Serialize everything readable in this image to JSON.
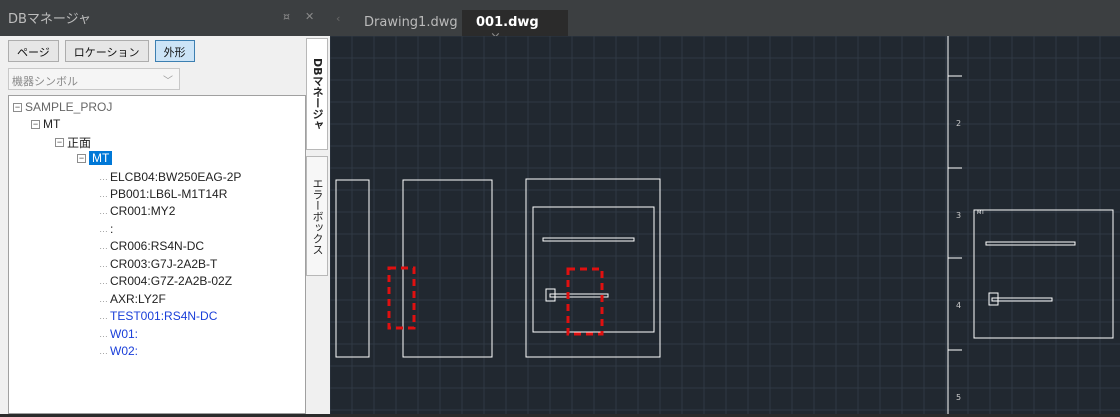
{
  "panel": {
    "title": "DBマネージャ",
    "pin_icon": "pin-icon",
    "close_icon": "close-icon",
    "buttons": [
      "ページ",
      "ロケーション",
      "外形"
    ],
    "active_button": "外形",
    "combo": {
      "value": "機器シンボル"
    }
  },
  "tree": {
    "root": "SAMPLE_PROJ",
    "mt": "MT",
    "front": "正面",
    "mt_selected": "MT",
    "items": [
      "ELCB04:BW250EAG-2P",
      "PB001:LB6L-M1T14R",
      "CR001:MY2",
      ":",
      "CR006:RS4N-DC",
      "CR003:G7J-2A2B-T",
      "CR004:G7Z-2A2B-02Z",
      "AXR:LY2F",
      "TEST001:RS4N-DC",
      "W01:",
      "W02:"
    ]
  },
  "side_tabs": [
    "DBマネージャ",
    "エラーボックス"
  ],
  "doc_tabs": [
    {
      "label": "Drawing1.dwg"
    },
    {
      "label": "001.dwg",
      "close": "×"
    }
  ],
  "ruler_labels": [
    "2",
    "3",
    "4",
    "5"
  ],
  "block_tag": "MT",
  "colors": {
    "canvas_bg": "#212830",
    "grid": "#2f3944",
    "highlight": "#e01010",
    "selection": "#0078d7"
  }
}
